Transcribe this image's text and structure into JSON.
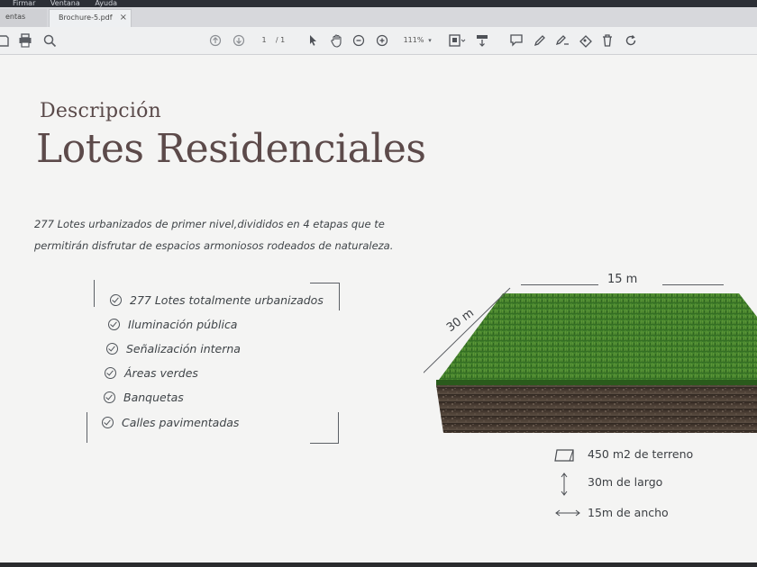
{
  "menubar": {
    "items": [
      "Firmar",
      "Ventana",
      "Ayuda"
    ]
  },
  "tabs": {
    "home_label": "entas",
    "doc_label": "Brochure-5.pdf",
    "close_glyph": "×"
  },
  "toolbar": {
    "page_current": "1",
    "page_total": "/ 1",
    "zoom": "111%"
  },
  "document": {
    "subtitle": "Descripción",
    "title": "Lotes Residenciales",
    "intro_line1": "277 Lotes urbanizados de primer nivel,divididos en 4 etapas que te",
    "intro_line2": "permitirán disfrutar de espacios armoniosos rodeados de naturaleza.",
    "features": [
      "277 Lotes totalmente urbanizados",
      "Iluminación pública",
      "Señalización interna",
      "Áreas verdes",
      "Banquetas",
      "Calles pavimentadas"
    ],
    "width_label": "15 m",
    "length_label": "30 m",
    "specs": [
      {
        "icon": "area-icon",
        "label": "450 m2 de terreno"
      },
      {
        "icon": "vertical-arrow-icon",
        "label": "30m de largo"
      },
      {
        "icon": "horizontal-arrow-icon",
        "label": "15m de ancho"
      }
    ]
  },
  "colors": {
    "title": "#5c4a4a",
    "grass": "#3f7a2a",
    "soil": "#3b2f27"
  }
}
